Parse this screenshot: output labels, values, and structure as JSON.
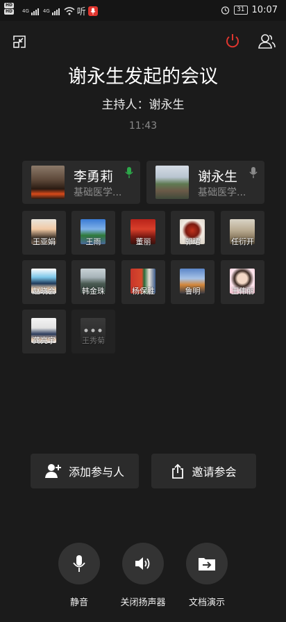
{
  "status_bar": {
    "hd_badges": [
      "HD",
      "HD"
    ],
    "network": [
      "4G",
      "4G"
    ],
    "app_label": "听",
    "battery": "31",
    "time": "10:07"
  },
  "header": {
    "title": "谢永生发起的会议",
    "host_label": "主持人：谢永生",
    "time": "11:43"
  },
  "featured": [
    {
      "name": "李勇莉",
      "dept": "基础医学...",
      "mic_color": "#2da84a"
    },
    {
      "name": "谢永生",
      "dept": "基础医学...",
      "mic_color": "#8a8a8a"
    }
  ],
  "participants": [
    {
      "name": "王亚娟"
    },
    {
      "name": "王雨"
    },
    {
      "name": "董丽"
    },
    {
      "name": "郭珺"
    },
    {
      "name": "任衍开"
    },
    {
      "name": "赵晓会"
    },
    {
      "name": "韩金珠"
    },
    {
      "name": "杨保胜"
    },
    {
      "name": "鲁明"
    },
    {
      "name": "王伟丽"
    },
    {
      "name": "龚亮宇"
    },
    {
      "name": "王秀菊"
    }
  ],
  "actions": {
    "add_participant": "添加参与人",
    "invite": "邀请参会"
  },
  "controls": {
    "mute": "静音",
    "speaker": "关闭扬声器",
    "doc_share": "文档演示"
  },
  "colors": {
    "background": "#1b1b1b",
    "card": "#2a2a2a",
    "end_call": "#e0362f",
    "mic_active": "#2da84a"
  }
}
